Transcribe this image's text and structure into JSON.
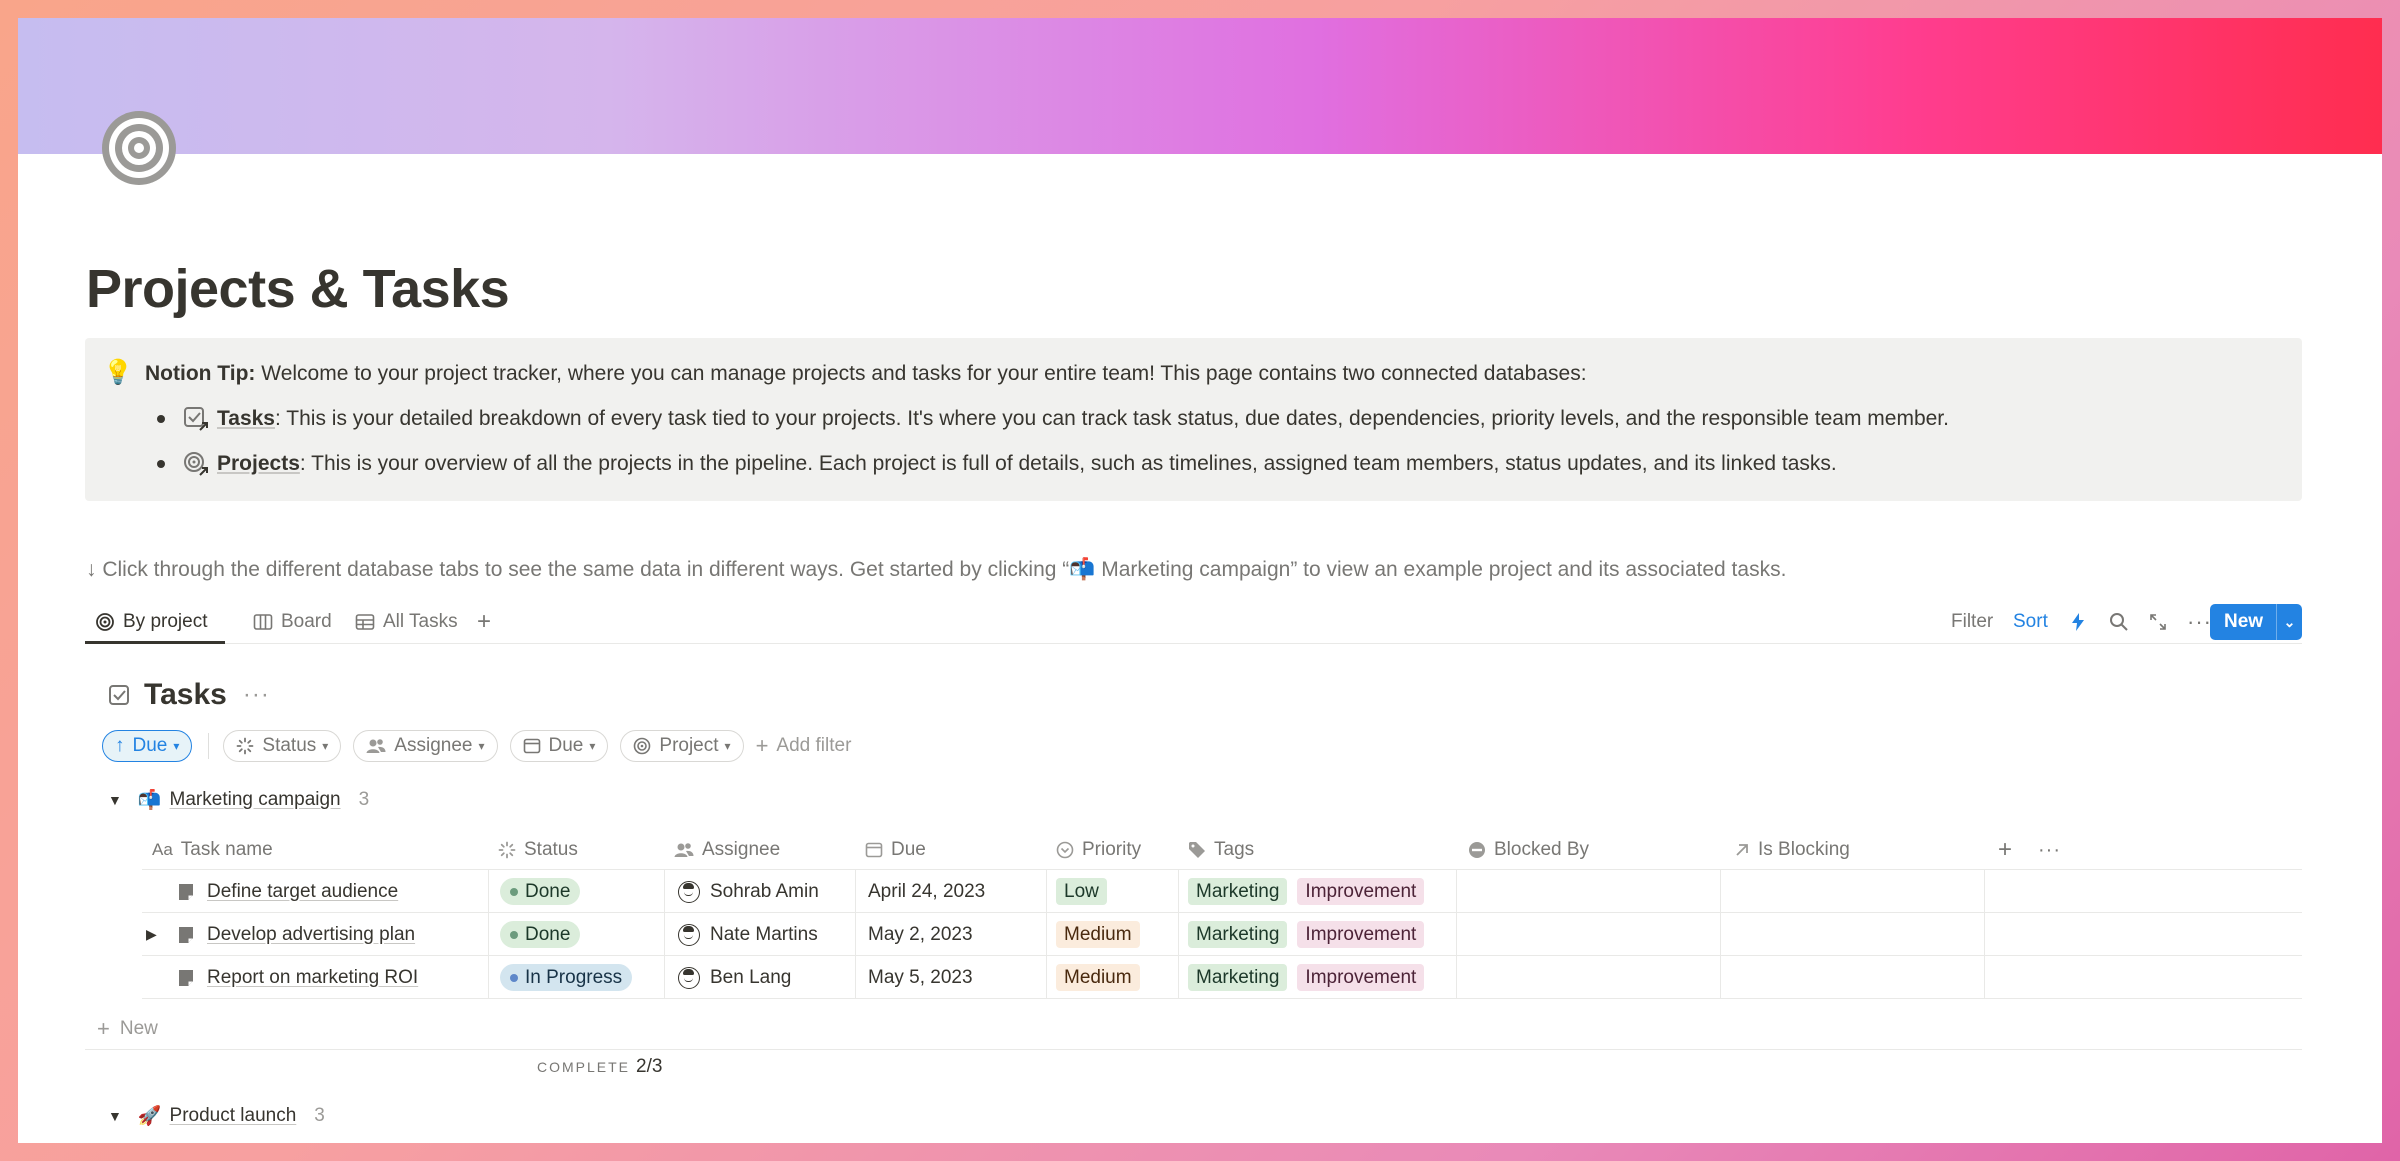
{
  "page": {
    "title": "Projects & Tasks",
    "callout": {
      "icon": "lightbulb-icon",
      "tip_label": "Notion Tip:",
      "tip_text": " Welcome to your project tracker, where you can manage projects and tasks for your entire team! This page contains two connected databases:",
      "items": [
        {
          "label": "Tasks",
          "text": ": This is your detailed breakdown of every task tied to your projects. It's where you can track task status, due dates, dependencies, priority levels, and the responsible team member."
        },
        {
          "label": "Projects",
          "text": ": This is your overview of all the projects in the pipeline. Each project is full of details, such as timelines, assigned team members, status updates, and its linked tasks."
        }
      ]
    },
    "hint": "↓ Click through the different database tabs to see the same data in different ways. Get started by clicking “📬 Marketing campaign” to view an example project and its associated tasks."
  },
  "viewbar": {
    "tabs": [
      {
        "label": "By project"
      },
      {
        "label": "Board"
      },
      {
        "label": "All Tasks"
      }
    ],
    "filter": "Filter",
    "sort": "Sort",
    "new": "New"
  },
  "database": {
    "title": "Tasks",
    "filters": {
      "sort_chip": "Due",
      "chips": [
        "Status",
        "Assignee",
        "Due",
        "Project"
      ],
      "add_filter": "Add filter"
    },
    "columns": [
      "Task name",
      "Status",
      "Assignee",
      "Due",
      "Priority",
      "Tags",
      "Blocked By",
      "Is Blocking"
    ],
    "groups": [
      {
        "emoji": "📬",
        "name": "Marketing campaign",
        "count": "3",
        "rows": [
          {
            "name": "Define target audience",
            "status": "Done",
            "assignee": "Sohrab Amin",
            "due": "April 24, 2023",
            "priority": "Low",
            "tags": [
              "Marketing",
              "Improvement"
            ]
          },
          {
            "name": "Develop advertising plan",
            "status": "Done",
            "assignee": "Nate Martins",
            "due": "May 2, 2023",
            "priority": "Medium",
            "tags": [
              "Marketing",
              "Improvement"
            ]
          },
          {
            "name": "Report on marketing ROI",
            "status": "In Progress",
            "assignee": "Ben Lang",
            "due": "May 5, 2023",
            "priority": "Medium",
            "tags": [
              "Marketing",
              "Improvement"
            ]
          }
        ],
        "new_label": "New",
        "complete_label": "COMPLETE",
        "complete_value": "2/3"
      },
      {
        "emoji": "🚀",
        "name": "Product launch",
        "count": "3"
      }
    ]
  },
  "colors": {
    "accent": "#2383e2",
    "done_bg": "#dbeddb",
    "progress_bg": "#d3e5ef",
    "medium_bg": "#fbecdd",
    "improvement_bg": "#f5e0e9"
  }
}
